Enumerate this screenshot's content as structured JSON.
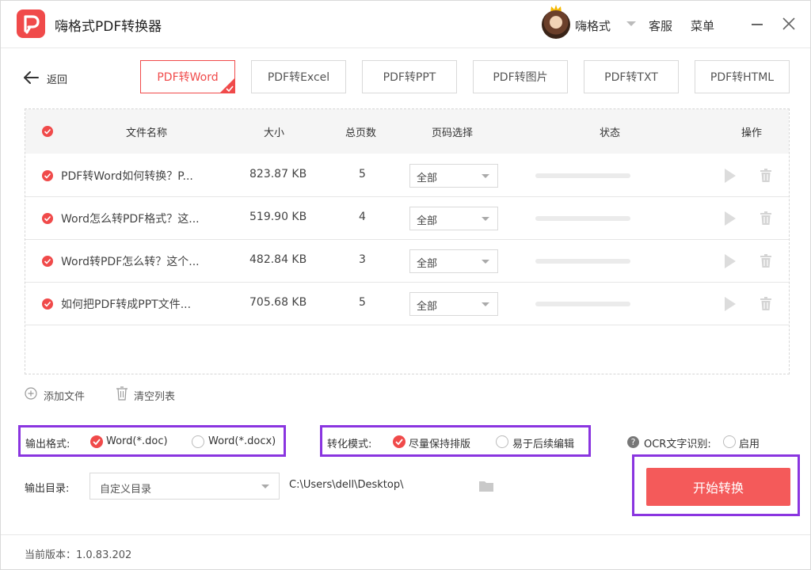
{
  "app": {
    "title": "嗨格式PDF转换器",
    "brand_color": "#f04a4a",
    "highlight_color": "#8a35e0"
  },
  "header": {
    "username": "嗨格式",
    "service_label": "客服",
    "menu_label": "菜单",
    "icons": [
      "app-logo-icon",
      "crown-icon",
      "chevron-down-icon",
      "minimize-icon",
      "close-icon"
    ]
  },
  "toolbar": {
    "back_label": "返回",
    "tabs": [
      {
        "label": "PDF转Word",
        "active": true
      },
      {
        "label": "PDF转Excel",
        "active": false
      },
      {
        "label": "PDF转PPT",
        "active": false
      },
      {
        "label": "PDF转图片",
        "active": false
      },
      {
        "label": "PDF转TXT",
        "active": false
      },
      {
        "label": "PDF转HTML",
        "active": false
      }
    ]
  },
  "table": {
    "columns": {
      "name": "文件名称",
      "size": "大小",
      "pages": "总页数",
      "range": "页码选择",
      "status": "状态",
      "actions": "操作"
    },
    "rows": [
      {
        "name": "PDF转Word如何转换？P...",
        "size": "823.87 KB",
        "pages": "5",
        "range": "全部",
        "progress": 0
      },
      {
        "name": "Word怎么转PDF格式？这...",
        "size": "519.90 KB",
        "pages": "4",
        "range": "全部",
        "progress": 0
      },
      {
        "name": "Word转PDF怎么转？这个...",
        "size": "482.84 KB",
        "pages": "3",
        "range": "全部",
        "progress": 0
      },
      {
        "name": "如何把PDF转成PPT文件...",
        "size": "705.68 KB",
        "pages": "5",
        "range": "全部",
        "progress": 0
      }
    ]
  },
  "actions": {
    "add_file": "添加文件",
    "clear_list": "清空列表"
  },
  "options": {
    "output_format": {
      "label": "输出格式:",
      "choices": [
        {
          "label": "Word(*.doc)",
          "selected": true
        },
        {
          "label": "Word(*.docx)",
          "selected": false
        }
      ]
    },
    "convert_mode": {
      "label": "转化模式:",
      "choices": [
        {
          "label": "尽量保持排版",
          "selected": true
        },
        {
          "label": "易于后续编辑",
          "selected": false
        }
      ]
    },
    "ocr": {
      "help": "?",
      "label": "OCR文字识别:",
      "choice": {
        "label": "启用",
        "selected": false
      }
    }
  },
  "output": {
    "label": "输出目录:",
    "dir_select": "自定义目录",
    "path": "C:\\Users\\dell\\Desktop\\"
  },
  "start_button": "开始转换",
  "footer": {
    "version": "当前版本：1.0.83.202"
  }
}
